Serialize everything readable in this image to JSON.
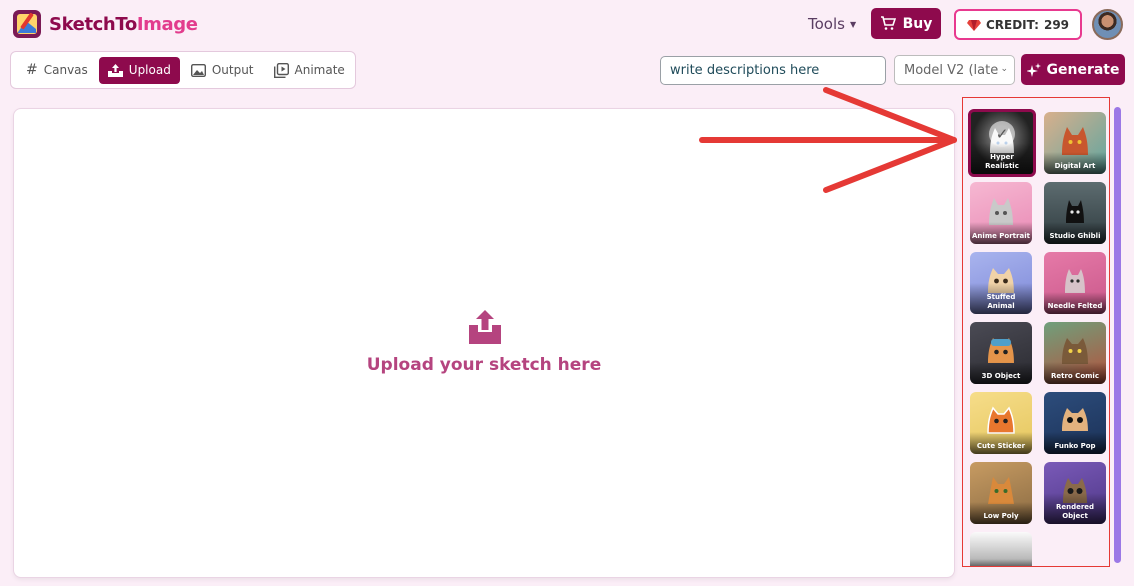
{
  "header": {
    "logo_text_a": "SketchTo",
    "logo_text_b": "Image",
    "tools_label": "Tools",
    "buy_label": "Buy",
    "credit_label": "CREDIT:",
    "credit_value": "299"
  },
  "toolbar": {
    "modes": [
      {
        "label": "Canvas",
        "icon": "hash-icon"
      },
      {
        "label": "Upload",
        "icon": "upload-tray-icon",
        "active": true
      },
      {
        "label": "Output",
        "icon": "image-icon"
      },
      {
        "label": "Animate",
        "icon": "play-frames-icon"
      }
    ],
    "description_value": "write descriptions here",
    "model_value": "Model V2 (late",
    "generate_label": "Generate"
  },
  "upload": {
    "prompt": "Upload your sketch here"
  },
  "styles": [
    {
      "label": "Hyper Realistic",
      "selected": true
    },
    {
      "label": "Digital Art"
    },
    {
      "label": "Anime Portrait"
    },
    {
      "label": "Studio Ghibli"
    },
    {
      "label": "Stuffed Animal"
    },
    {
      "label": "Needle Felted"
    },
    {
      "label": "3D Object"
    },
    {
      "label": "Retro Comic"
    },
    {
      "label": "Cute Sticker"
    },
    {
      "label": "Funko Pop"
    },
    {
      "label": "Low Poly"
    },
    {
      "label": "Rendered Object"
    },
    {
      "label": ""
    }
  ],
  "colors": {
    "brand": "#8e0a4d",
    "accent_pink": "#e8398f",
    "annotation_red": "#e53935",
    "scrollbar": "#9b78e6"
  }
}
